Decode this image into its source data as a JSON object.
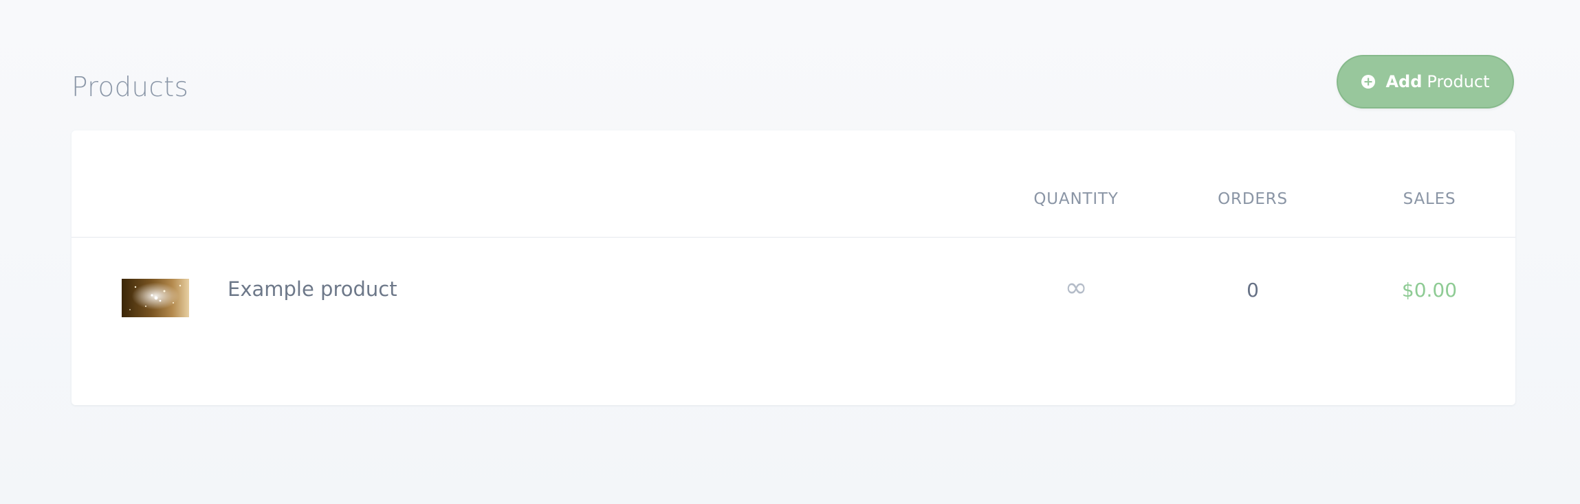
{
  "page": {
    "title": "Products"
  },
  "toolbar": {
    "add_label_strong": "Add",
    "add_label_light": "Product"
  },
  "table": {
    "headers": [
      "QUANTITY",
      "ORDERS",
      "SALES"
    ],
    "rows": [
      {
        "name": "Example product",
        "quantity": "∞",
        "orders": "0",
        "sales": "$0.00"
      }
    ]
  },
  "icons": {
    "add": "plus-circle-icon",
    "thumbnail": "product-thumbnail"
  },
  "colors": {
    "accent": "#98c79c",
    "sales": "#8ecb94",
    "title": "#8b97a8"
  }
}
